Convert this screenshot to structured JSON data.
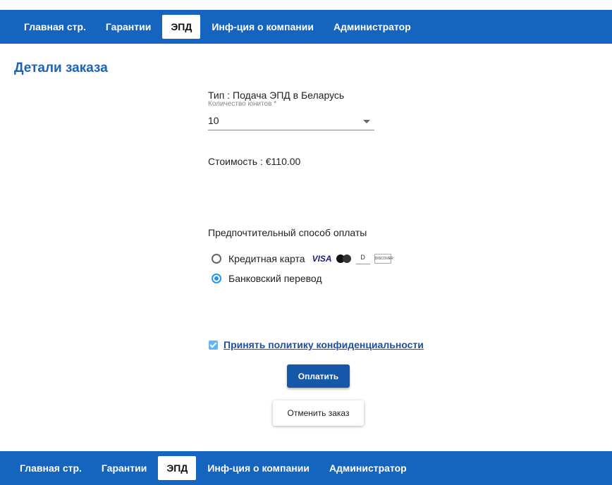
{
  "nav": {
    "items": [
      "Главная стр.",
      "Гарантии",
      "ЭПД",
      "Инф-ция о компании",
      "Администратор"
    ],
    "active_index": 2
  },
  "page_title": "Детали заказа",
  "order": {
    "type_line": "Тип : Подача ЭПД в Беларусь",
    "units_label": "Количество юнитов *",
    "units_value": "10",
    "cost_line": "Стоимость : €110.00"
  },
  "payment": {
    "title": "Предпочтительный способ оплаты",
    "options": [
      {
        "label": "Кредитная карта",
        "selected": false,
        "icons": [
          "visa-icon",
          "mastercard-icon",
          "diners-club-icon",
          "discover-icon"
        ]
      },
      {
        "label": "Банковский перевод",
        "selected": true
      }
    ],
    "card_brands": {
      "visa": "VISA",
      "diners": "D",
      "discover": "DISCOVER"
    }
  },
  "policy": {
    "label": "Принять политику конфиденциальности",
    "checked": true
  },
  "buttons": {
    "pay": "Оплатить",
    "cancel": "Отменить заказ"
  },
  "colors": {
    "nav": "#1565c0",
    "title": "#1e62b8",
    "primary_button": "#1557a8",
    "radio_accent": "#2196f3"
  }
}
